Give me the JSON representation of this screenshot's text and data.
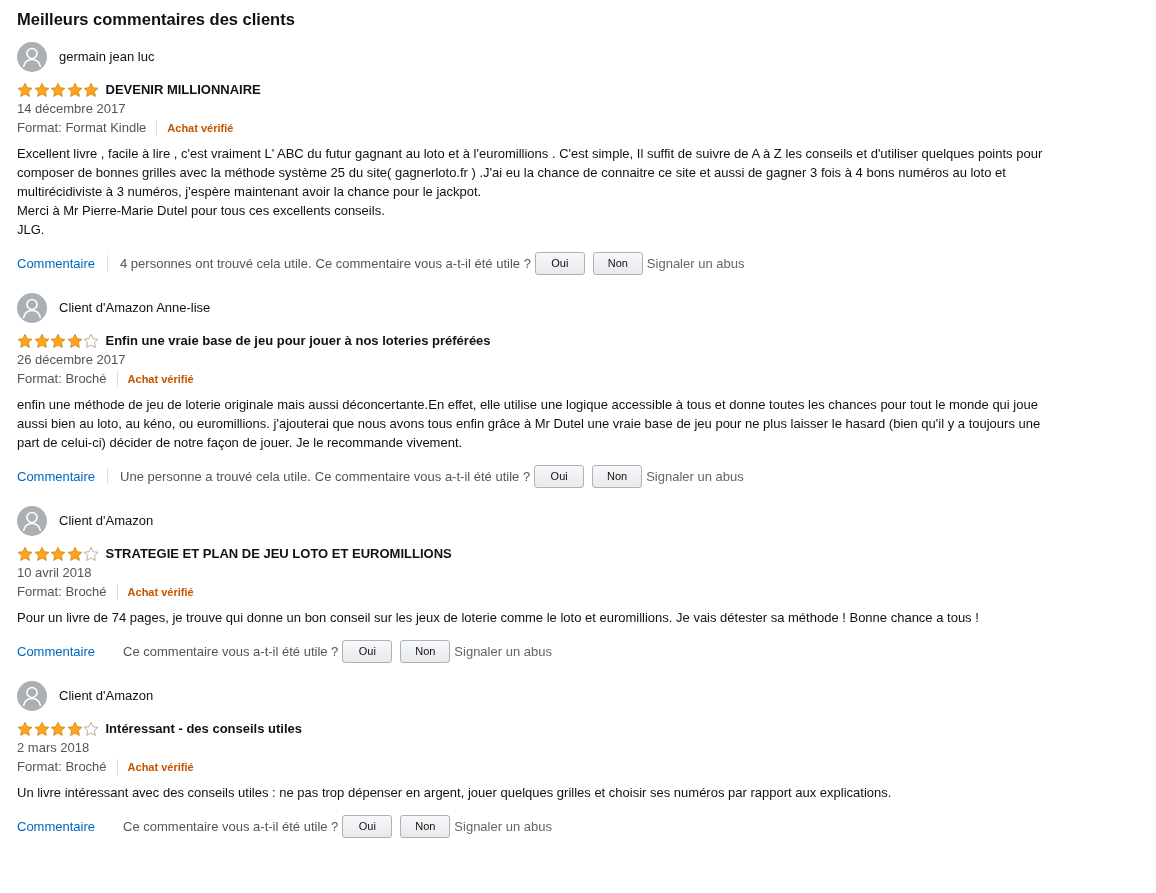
{
  "heading": "Meilleurs commentaires des clients",
  "reviews": [
    {
      "author": "germain jean luc",
      "stars": 5,
      "title": "DEVENIR MILLIONNAIRE",
      "date": "14 décembre 2017",
      "format": "Format: Format Kindle",
      "verified": "Achat vérifié",
      "paragraphs": [
        "Excellent livre , facile à lire , c'est vraiment L' ABC du futur gagnant au loto et à l'euromillions . C'est simple, Il suffit de suivre de A à Z les conseils et d'utiliser quelques points pour composer de bonnes grilles avec la méthode système 25 du site( gagnerloto.fr ) .J'ai eu la chance de connaitre ce site et aussi de gagner 3 fois à 4 bons numéros au loto et multirécidiviste à 3 numéros, j'espère maintenant avoir la chance pour le jackpot.",
        "Merci à Mr Pierre-Marie Dutel pour tous ces excellents conseils.",
        "JLG."
      ],
      "comment_link": "Commentaire",
      "helpful_count": "4 personnes ont trouvé cela utile.",
      "helpful_question": "Ce commentaire vous a-t-il été utile ?",
      "yes": "Oui",
      "no": "Non",
      "report": "Signaler un abus"
    },
    {
      "author": "Client d'Amazon Anne-lise",
      "stars": 4,
      "title": "Enfin une vraie base de jeu pour jouer à nos loteries préférées",
      "date": "26 décembre 2017",
      "format": "Format: Broché",
      "verified": "Achat vérifié",
      "paragraphs": [
        "enfin une méthode de jeu de loterie originale mais aussi déconcertante.En effet, elle utilise une logique accessible à tous et donne toutes les chances pour tout le monde qui joue aussi bien au loto, au kéno, ou euromillions. j'ajouterai que nous avons tous enfin grâce à Mr Dutel une vraie base de jeu pour ne plus laisser le hasard (bien qu'il y a toujours une part de celui-ci) décider de notre façon de jouer. Je le recommande vivement."
      ],
      "comment_link": "Commentaire",
      "helpful_count": "Une personne a trouvé cela utile.",
      "helpful_question": "Ce commentaire vous a-t-il été utile ?",
      "yes": "Oui",
      "no": "Non",
      "report": "Signaler un abus"
    },
    {
      "author": "Client d'Amazon",
      "stars": 4,
      "title": "STRATEGIE ET PLAN DE JEU LOTO ET EUROMILLIONS",
      "date": "10 avril 2018",
      "format": "Format: Broché",
      "verified": "Achat vérifié",
      "paragraphs": [
        "Pour un livre de 74 pages, je trouve qui donne un bon conseil sur les jeux de loterie comme le loto et euromillions. Je vais détester sa méthode ! Bonne chance a tous !"
      ],
      "comment_link": "Commentaire",
      "helpful_question": "Ce commentaire vous a-t-il été utile ?",
      "yes": "Oui",
      "no": "Non",
      "report": "Signaler un abus"
    },
    {
      "author": "Client d'Amazon",
      "stars": 4,
      "title": "Intéressant - des conseils utiles",
      "date": "2 mars 2018",
      "format": "Format: Broché",
      "verified": "Achat vérifié",
      "paragraphs": [
        "Un livre intéressant avec des conseils utiles : ne pas trop dépenser en argent, jouer quelques grilles et choisir ses numéros par rapport aux explications."
      ],
      "comment_link": "Commentaire",
      "helpful_question": "Ce commentaire vous a-t-il été utile ?",
      "yes": "Oui",
      "no": "Non",
      "report": "Signaler un abus"
    }
  ]
}
